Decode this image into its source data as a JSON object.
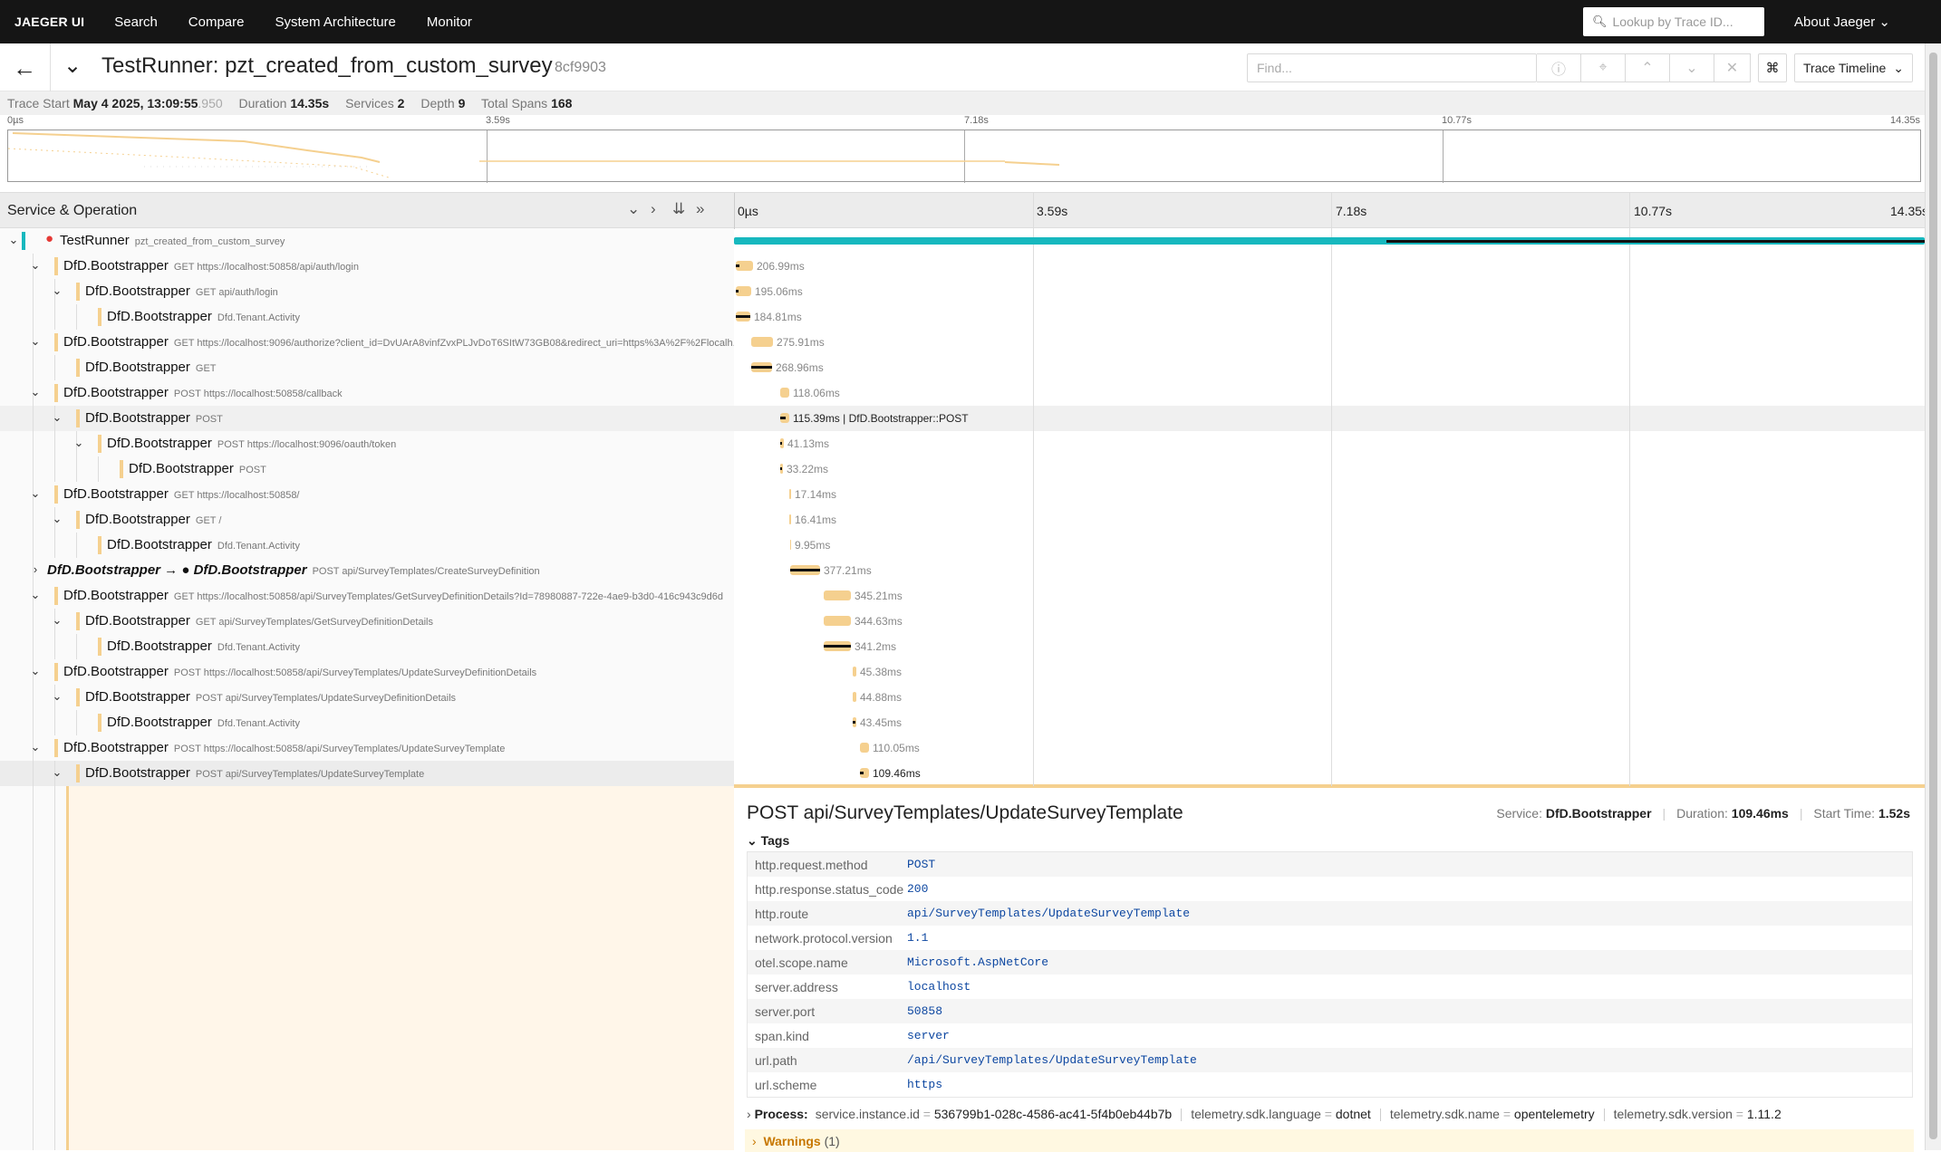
{
  "nav": {
    "brand": "JAEGER UI",
    "links": [
      "Search",
      "Compare",
      "System Architecture",
      "Monitor"
    ],
    "lookup_placeholder": "Lookup by Trace ID...",
    "about": "About Jaeger"
  },
  "trace": {
    "title": "TestRunner: pzt_created_from_custom_survey",
    "id": "8cf9903",
    "find_placeholder": "Find...",
    "view": "Trace Timeline"
  },
  "meta": {
    "start_label": "Trace Start",
    "start": "May 4 2025, 13:09:55",
    "start_ms": ".950",
    "duration_label": "Duration",
    "duration": "14.35s",
    "services_label": "Services",
    "services": "2",
    "depth_label": "Depth",
    "depth": "9",
    "spans_label": "Total Spans",
    "spans": "168"
  },
  "ticks": [
    "0µs",
    "3.59s",
    "7.18s",
    "10.77s",
    "14.35s"
  ],
  "pane": {
    "title": "Service & Operation"
  },
  "rows": [
    {
      "svc": "TestRunner",
      "op": "pzt_created_from_custom_survey",
      "dur": "",
      "depth": 0,
      "chev": "v",
      "color": "#17b8be",
      "error": true
    },
    {
      "svc": "DfD.Bootstrapper",
      "op": "GET https://localhost:50858/api/auth/login",
      "dur": "206.99ms",
      "depth": 1,
      "chev": "v",
      "color": "#f5d08f"
    },
    {
      "svc": "DfD.Bootstrapper",
      "op": "GET api/auth/login",
      "dur": "195.06ms",
      "depth": 2,
      "chev": "v",
      "color": "#f5d08f"
    },
    {
      "svc": "DfD.Bootstrapper",
      "op": "Dfd.Tenant.Activity",
      "dur": "184.81ms",
      "depth": 3,
      "chev": "",
      "color": "#f5d08f"
    },
    {
      "svc": "DfD.Bootstrapper",
      "op": "GET https://localhost:9096/authorize?client_id=DvUArA8vinfZvxPLJvDoT6SItW73GB08&redirect_uri=https%3A%2F%2Flocalh...",
      "dur": "275.91ms",
      "depth": 1,
      "chev": "v",
      "color": "#f5d08f"
    },
    {
      "svc": "DfD.Bootstrapper",
      "op": "GET",
      "dur": "268.96ms",
      "depth": 2,
      "chev": "",
      "color": "#f5d08f"
    },
    {
      "svc": "DfD.Bootstrapper",
      "op": "POST https://localhost:50858/callback",
      "dur": "118.06ms",
      "depth": 1,
      "chev": "v",
      "color": "#f5d08f"
    },
    {
      "svc": "DfD.Bootstrapper",
      "op": "POST",
      "dur": "115.39ms | DfD.Bootstrapper::POST",
      "depth": 2,
      "chev": "v",
      "color": "#f5d08f",
      "hl": true
    },
    {
      "svc": "DfD.Bootstrapper",
      "op": "POST https://localhost:9096/oauth/token",
      "dur": "41.13ms",
      "depth": 3,
      "chev": "v",
      "color": "#f5d08f"
    },
    {
      "svc": "DfD.Bootstrapper",
      "op": "POST",
      "dur": "33.22ms",
      "depth": 4,
      "chev": "",
      "color": "#f5d08f"
    },
    {
      "svc": "DfD.Bootstrapper",
      "op": "GET https://localhost:50858/",
      "dur": "17.14ms",
      "depth": 1,
      "chev": "v",
      "color": "#f5d08f"
    },
    {
      "svc": "DfD.Bootstrapper",
      "op": "GET /",
      "dur": "16.41ms",
      "depth": 2,
      "chev": "v",
      "color": "#f5d08f"
    },
    {
      "svc": "DfD.Bootstrapper",
      "op": "Dfd.Tenant.Activity",
      "dur": "9.95ms",
      "depth": 3,
      "chev": "",
      "color": "#f5d08f"
    },
    {
      "svc": "DfD.Bootstrapper → ● DfD.Bootstrapper",
      "op": "POST api/SurveyTemplates/CreateSurveyDefinition",
      "dur": "377.21ms",
      "depth": 1,
      "chev": ">",
      "color": "",
      "bold": true
    },
    {
      "svc": "DfD.Bootstrapper",
      "op": "GET https://localhost:50858/api/SurveyTemplates/GetSurveyDefinitionDetails?Id=78980887-722e-4ae9-b3d0-416c943c9d6d",
      "dur": "345.21ms",
      "depth": 1,
      "chev": "v",
      "color": "#f5d08f"
    },
    {
      "svc": "DfD.Bootstrapper",
      "op": "GET api/SurveyTemplates/GetSurveyDefinitionDetails",
      "dur": "344.63ms",
      "depth": 2,
      "chev": "v",
      "color": "#f5d08f"
    },
    {
      "svc": "DfD.Bootstrapper",
      "op": "Dfd.Tenant.Activity",
      "dur": "341.2ms",
      "depth": 3,
      "chev": "",
      "color": "#f5d08f"
    },
    {
      "svc": "DfD.Bootstrapper",
      "op": "POST https://localhost:50858/api/SurveyTemplates/UpdateSurveyDefinitionDetails",
      "dur": "45.38ms",
      "depth": 1,
      "chev": "v",
      "color": "#f5d08f"
    },
    {
      "svc": "DfD.Bootstrapper",
      "op": "POST api/SurveyTemplates/UpdateSurveyDefinitionDetails",
      "dur": "44.88ms",
      "depth": 2,
      "chev": "v",
      "color": "#f5d08f"
    },
    {
      "svc": "DfD.Bootstrapper",
      "op": "Dfd.Tenant.Activity",
      "dur": "43.45ms",
      "depth": 3,
      "chev": "",
      "color": "#f5d08f"
    },
    {
      "svc": "DfD.Bootstrapper",
      "op": "POST https://localhost:50858/api/SurveyTemplates/UpdateSurveyTemplate",
      "dur": "110.05ms",
      "depth": 1,
      "chev": "v",
      "color": "#f5d08f"
    },
    {
      "svc": "DfD.Bootstrapper",
      "op": "POST api/SurveyTemplates/UpdateSurveyTemplate",
      "dur": "109.46ms",
      "depth": 2,
      "chev": "v",
      "color": "#f5d08f",
      "sel": true
    }
  ],
  "detail": {
    "title": "POST api/SurveyTemplates/UpdateSurveyTemplate",
    "service_label": "Service:",
    "service": "DfD.Bootstrapper",
    "duration_label": "Duration:",
    "duration": "109.46ms",
    "start_label": "Start Time:",
    "start": "1.52s",
    "tags_label": "Tags",
    "tags": [
      {
        "k": "http.request.method",
        "v": "POST"
      },
      {
        "k": "http.response.status_code",
        "v": "200"
      },
      {
        "k": "http.route",
        "v": "api/SurveyTemplates/UpdateSurveyTemplate"
      },
      {
        "k": "network.protocol.version",
        "v": "1.1"
      },
      {
        "k": "otel.scope.name",
        "v": "Microsoft.AspNetCore"
      },
      {
        "k": "server.address",
        "v": "localhost"
      },
      {
        "k": "server.port",
        "v": "50858"
      },
      {
        "k": "span.kind",
        "v": "server"
      },
      {
        "k": "url.path",
        "v": "/api/SurveyTemplates/UpdateSurveyTemplate"
      },
      {
        "k": "url.scheme",
        "v": "https"
      }
    ],
    "process_label": "Process:",
    "process": [
      {
        "k": "service.instance.id",
        "v": "536799b1-028c-4586-ac41-5f4b0eb44b7b"
      },
      {
        "k": "telemetry.sdk.language",
        "v": "dotnet"
      },
      {
        "k": "telemetry.sdk.name",
        "v": "opentelemetry"
      },
      {
        "k": "telemetry.sdk.version",
        "v": "1.11.2"
      }
    ],
    "warnings_label": "Warnings",
    "warnings_count": "(1)"
  }
}
